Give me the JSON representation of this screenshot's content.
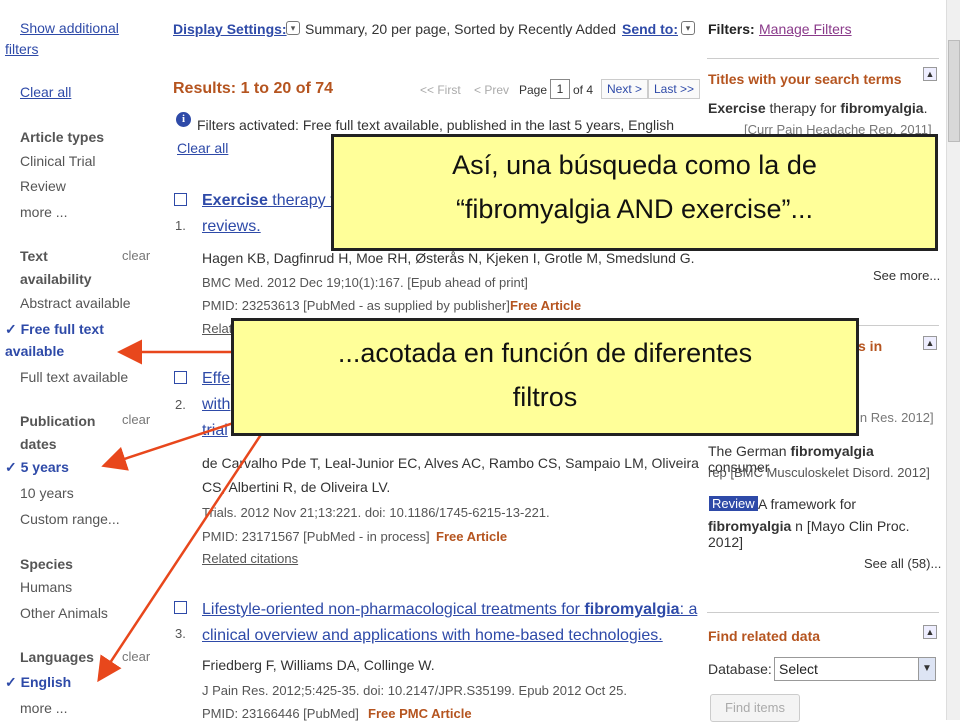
{
  "sidebar": {
    "show_additional": "Show additional",
    "filters_word": "filters",
    "clear_all": "Clear all",
    "article_types_head": "Article types",
    "article_types": [
      "Clinical Trial",
      "Review",
      "more ..."
    ],
    "text_avail_head_1": "Text",
    "text_avail_head_2": "availability",
    "text_avail_clear": "clear",
    "abstract_available": "Abstract available",
    "free_full_text_1": "Free full text",
    "free_full_text_2": "available",
    "full_text_available": "Full text available",
    "pub_dates_head_1": "Publication",
    "pub_dates_head_2": "dates",
    "pub_dates_clear": "clear",
    "five_years": "5 years",
    "ten_years": "10 years",
    "custom_range": "Custom range...",
    "species_head": "Species",
    "species": [
      "Humans",
      "Other Animals"
    ],
    "languages_head": "Languages",
    "languages_clear": "clear",
    "english": "English",
    "lang_more": "more ..."
  },
  "topbar": {
    "display_settings_label": "Display Settings:",
    "display_settings_value": "Summary, 20 per page, Sorted by Recently Added",
    "send_to_label": "Send to:"
  },
  "results": {
    "heading": "Results: 1 to 20 of 74",
    "pager": {
      "first": "<< First",
      "prev": "< Prev",
      "page_label": "Page",
      "page_value": "1",
      "of_pages": "of 4",
      "next": "Next >",
      "last": "Last >>"
    },
    "filters_notice": "Filters activated: Free full text available, published in the last 5 years, English",
    "clear_all": "Clear all",
    "items": [
      {
        "num": "1.",
        "title_bold": "Exercise",
        "title_rest": " therapy fo",
        "title_line2": "reviews.",
        "authors": "Hagen KB, Dagfinrud H, Moe RH, Østerås N, Kjeken I, Grotle M, Smedslund G.",
        "citation": "BMC Med. 2012 Dec 19;10(1):167. [Epub ahead of print]",
        "pmid": "PMID: 23253613 [PubMed - as supplied by publisher]",
        "free": "Free Article",
        "related": "Relat"
      },
      {
        "num": "2.",
        "title_part1": "Effe",
        "title_part2": "with",
        "title_part3": "trial",
        "authors_1": "de Carvalho Pde T, Leal-Junior EC, Alves AC, Rambo CS, Sampaio LM, Oliveira",
        "authors_2": "CS, Albertini R, de Oliveira LV.",
        "citation": "Trials. 2012 Nov 21;13:221. doi: 10.1186/1745-6215-13-221.",
        "pmid": "PMID: 23171567 [PubMed - in process]",
        "free": "Free Article",
        "related": "Related citations"
      },
      {
        "num": "3.",
        "title_1": "Lifestyle-oriented non-pharmacological treatments for ",
        "title_kw": "fibromyalgia",
        "title_1_end": ": a",
        "title_2": "clinical overview and applications with home-based technologies.",
        "authors": "Friedberg F, Williams DA, Collinge W.",
        "citation": "J Pain Res. 2012;5:425-35. doi: 10.2147/JPR.S35199. Epub 2012 Oct 25.",
        "pmid": "PMID: 23166446 [PubMed]",
        "free": "Free PMC Article"
      }
    ]
  },
  "right_panel": {
    "filters_label": "Filters:",
    "manage_filters": "Manage Filters",
    "titles_head": "Titles with your search terms",
    "titles_item_kw1": "Exercise",
    "titles_item_mid": " therapy for ",
    "titles_item_kw2": "fibromyalgia",
    "titles_item_end": ".",
    "titles_item_src": "[Curr Pain Headache Rep. 2011]",
    "see_more": "See more...",
    "second_head_frag": "s in",
    "frag_res": "in Res. 2012]",
    "german_1": "The German ",
    "german_kw": "fibromyalgia",
    "german_2": " consumer",
    "german_3": "rep [BMC Musculoskelet Disord. 2012]",
    "review_badge": "Review",
    "framework_1": " A framework for",
    "framework_kw": "fibromyalgia",
    "framework_2": " n [Mayo Clin Proc. 2012]",
    "see_all": "See all (58)...",
    "find_related_head": "Find related data",
    "database_label": "Database:",
    "database_value": "Select",
    "find_items": "Find items"
  },
  "callouts": {
    "top_line1": "Así, una búsqueda como la de",
    "top_line2": "“fibromyalgia AND exercise”...",
    "mid_line1": "...acotada en función de diferentes",
    "mid_line2": "filtros"
  },
  "colors": {
    "link": "#2e4aa8",
    "accent": "#b5541f",
    "callout_bg": "#ffff99",
    "arrow": "#e8471c"
  }
}
